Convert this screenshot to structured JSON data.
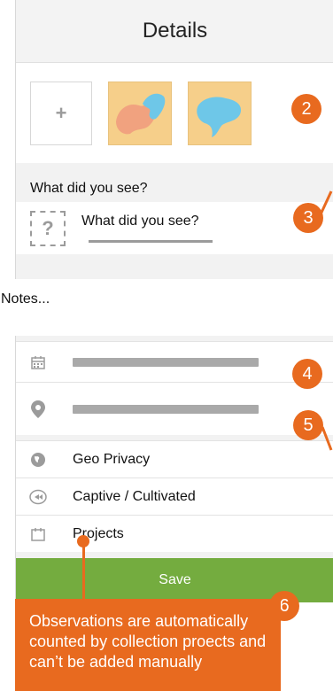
{
  "header": {
    "title": "Details"
  },
  "photos": {
    "add_label": "+",
    "thumbnail_count": 2
  },
  "species": {
    "section_label": "What did you see?",
    "input_text": "What did you see?",
    "placeholder_icon": "?"
  },
  "notes": {
    "placeholder": "Notes..."
  },
  "rows": [
    {
      "icon": "calendar-icon",
      "label": ""
    },
    {
      "icon": "location-pin-icon",
      "label": ""
    },
    {
      "icon": "globe-icon",
      "label": "Geo Privacy"
    },
    {
      "icon": "captive-icon",
      "label": "Captive / Cultivated"
    },
    {
      "icon": "projects-icon",
      "label": "Projects"
    }
  ],
  "save": {
    "label": "Save"
  },
  "annotations": {
    "badges": [
      "2",
      "3",
      "4",
      "5",
      "6"
    ],
    "callout_text": "Observations are automatically counted by collection proects and can’t be added manually"
  },
  "colors": {
    "accent_orange": "#e86a1f",
    "save_green": "#74ac3f",
    "photo_bg": "#f6cf8a",
    "blob_blue": "#6ec7e8",
    "blob_pink": "#f1a27f"
  }
}
